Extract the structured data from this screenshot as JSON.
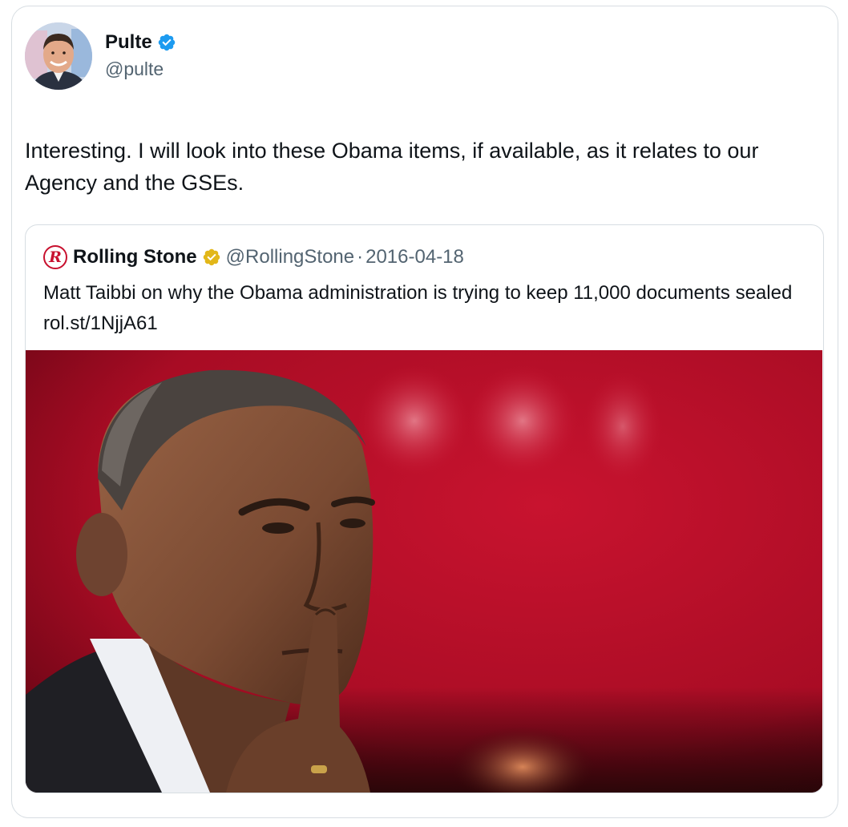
{
  "tweet": {
    "author": {
      "display_name": "Pulte",
      "handle": "@pulte",
      "verified_color": "#1d9bf0"
    },
    "text": "Interesting. I will look into these Obama items, if available, as it relates to our Agency and the GSEs."
  },
  "quoted_tweet": {
    "display_name": "Rolling Stone",
    "logo_letter": "R",
    "handle": "@RollingStone",
    "separator": "·",
    "date": "2016-04-18",
    "verified_color": "#e2b719",
    "text": "Matt Taibbi on why the Obama administration is trying to keep 11,000 documents sealed rol.st/1NjjA61",
    "image": {
      "background_color": "#b0102a"
    }
  }
}
